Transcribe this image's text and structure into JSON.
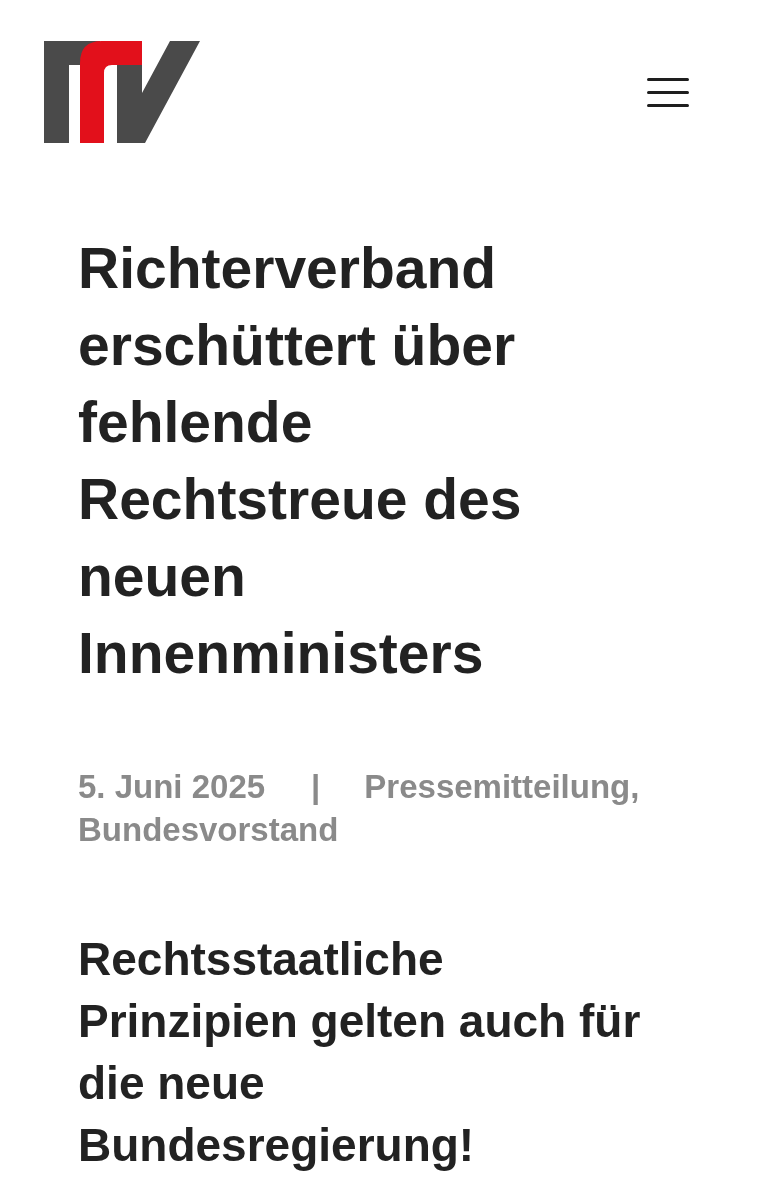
{
  "article": {
    "title": "Richterverband erschüttert über fehlende Rechtstreue des neuen Innenministers",
    "meta": {
      "date": "5. Juni 2025",
      "separator": "|",
      "categories": [
        "Pressemitteilung,",
        "Bundesvorstand"
      ]
    },
    "subtitle": "Rechtsstaatliche Prinzipien gelten auch für die neue Bundesregierung!"
  }
}
